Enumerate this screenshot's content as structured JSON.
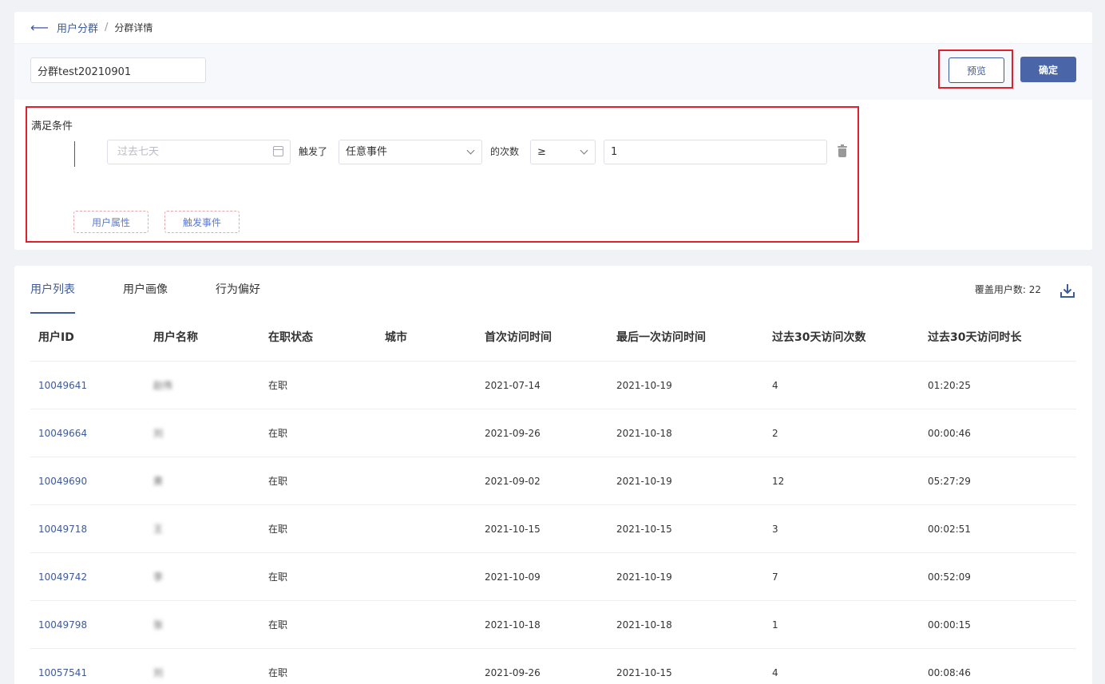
{
  "breadcrumb": {
    "parent": "用户分群",
    "separator": "/",
    "current": "分群详情"
  },
  "segment": {
    "name_value": "分群test20210901"
  },
  "actions": {
    "preview_label": "预览",
    "confirm_label": "确定"
  },
  "condition": {
    "title": "满足条件",
    "date_placeholder": "过去七天",
    "triggered_label": "触发了",
    "event_select": "任意事件",
    "count_label": "的次数",
    "operator_select": "≥",
    "count_value": "1",
    "add_user_attr_label": "用户属性",
    "add_event_label": "触发事件"
  },
  "tabs": [
    {
      "label": "用户列表",
      "active": true
    },
    {
      "label": "用户画像",
      "active": false
    },
    {
      "label": "行为偏好",
      "active": false
    }
  ],
  "coverage": {
    "label": "覆盖用户数:",
    "count": "22"
  },
  "table": {
    "headers": [
      "用户ID",
      "用户名称",
      "在职状态",
      "城市",
      "首次访问时间",
      "最后一次访问时间",
      "过去30天访问次数",
      "过去30天访问时长"
    ],
    "rows": [
      [
        "10049641",
        "赵伟",
        "在职",
        "",
        "2021-07-14",
        "2021-10-19",
        "4",
        "01:20:25"
      ],
      [
        "10049664",
        "刘",
        "在职",
        "",
        "2021-09-26",
        "2021-10-18",
        "2",
        "00:00:46"
      ],
      [
        "10049690",
        "黄",
        "在职",
        "",
        "2021-09-02",
        "2021-10-19",
        "12",
        "05:27:29"
      ],
      [
        "10049718",
        "王",
        "在职",
        "",
        "2021-10-15",
        "2021-10-15",
        "3",
        "00:02:51"
      ],
      [
        "10049742",
        "李",
        "在职",
        "",
        "2021-10-09",
        "2021-10-19",
        "7",
        "00:52:09"
      ],
      [
        "10049798",
        "张",
        "在职",
        "",
        "2021-10-18",
        "2021-10-18",
        "1",
        "00:00:15"
      ],
      [
        "10057541",
        "刘",
        "在职",
        "",
        "2021-09-26",
        "2021-10-15",
        "4",
        "00:08:46"
      ]
    ]
  },
  "colors": {
    "accent": "#3d5a9e",
    "highlight": "#e0202a",
    "primary_button": "#4a66a8"
  }
}
